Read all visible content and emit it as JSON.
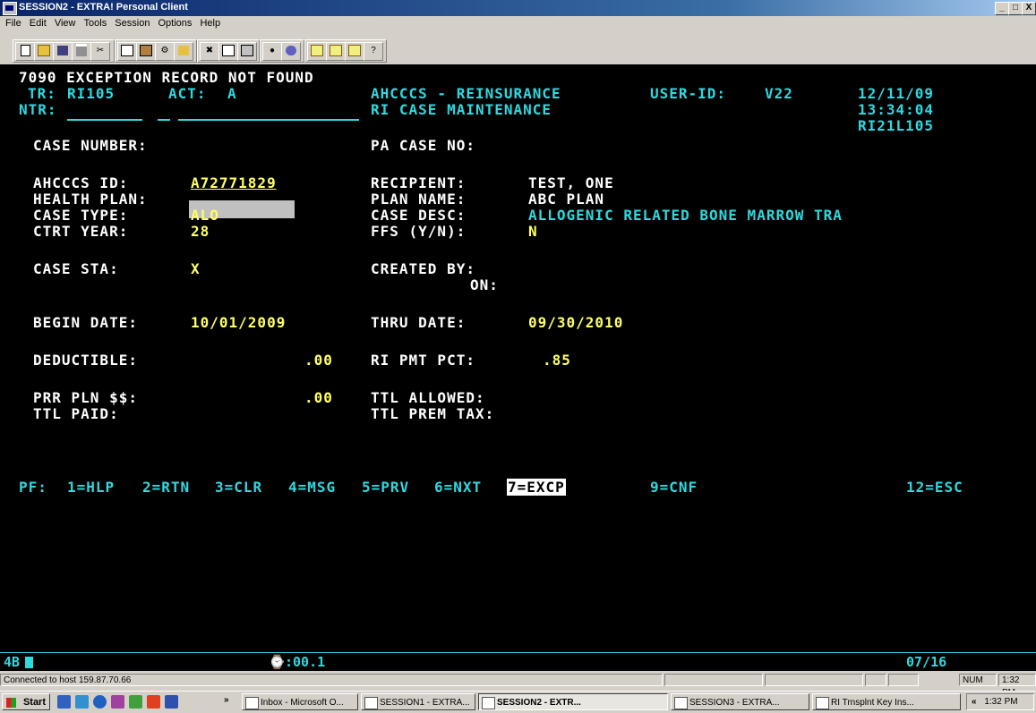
{
  "window": {
    "title": "SESSION2 - EXTRA! Personal Client",
    "controls": [
      "_",
      "□",
      "X"
    ]
  },
  "menu": [
    "File",
    "Edit",
    "View",
    "Tools",
    "Session",
    "Options",
    "Help"
  ],
  "screen": {
    "message": "7090 EXCEPTION RECORD NOT FOUND",
    "tr_label": "TR:",
    "tr_value": "RI105",
    "act_label": "ACT:",
    "act_value": "A",
    "ntr_label": "NTR:",
    "system_title": "AHCCCS - REINSURANCE",
    "screen_title": "RI CASE MAINTENANCE",
    "user_id_label": "USER-ID:",
    "user_id_value": "V22",
    "date": "12/11/09",
    "time": "13:34:04",
    "screen_id": "RI21L105",
    "case_number_label": "CASE NUMBER:",
    "pa_case_label": "PA CASE NO:",
    "ahcccs_id_label": "AHCCCS ID:",
    "ahcccs_id_value": "A72771829",
    "recipient_label": "RECIPIENT:",
    "recipient_value": "TEST, ONE",
    "health_plan_label": "HEALTH PLAN:",
    "plan_name_label": "PLAN NAME:",
    "plan_name_value": "ABC PLAN",
    "case_type_label": "CASE TYPE:",
    "case_type_value": "ALO",
    "case_desc_label": "CASE DESC:",
    "case_desc_value": "ALLOGENIC RELATED BONE MARROW TRA",
    "ctrt_year_label": "CTRT YEAR:",
    "ctrt_year_value": "28",
    "ffs_label": "FFS (Y/N):",
    "ffs_value": "N",
    "case_sta_label": "CASE STA:",
    "case_sta_value": "X",
    "created_by_label": "CREATED BY:",
    "on_label": "ON:",
    "begin_date_label": "BEGIN DATE:",
    "begin_date_value": "10/01/2009",
    "thru_date_label": "THRU DATE:",
    "thru_date_value": "09/30/2010",
    "deductible_label": "DEDUCTIBLE:",
    "deductible_value": ".00",
    "ri_pmt_pct_label": "RI PMT PCT:",
    "ri_pmt_pct_value": ".85",
    "prr_pln_label": "PRR PLN $$:",
    "prr_pln_value": ".00",
    "ttl_allowed_label": "TTL ALLOWED:",
    "ttl_paid_label": "TTL PAID:",
    "ttl_prem_tax_label": "TTL PREM TAX:",
    "pf_prefix": "PF:",
    "pf_keys": [
      "1=HLP",
      "2=RTN",
      "3=CLR",
      "4=MSG",
      "5=PRV",
      "6=NXT",
      "7=EXCP",
      "9=CNF",
      "12=ESC"
    ]
  },
  "oia": {
    "indicator": "4B",
    "timer": ":00.1",
    "cursor_pos": "07/16"
  },
  "status_bar": {
    "connection": "Connected to host 159.87.70.66",
    "num": "NUM",
    "time": "1:32 PM"
  },
  "taskbar": {
    "start": "Start",
    "chevron": "»",
    "tasks": [
      "Inbox - Microsoft O...",
      "SESSION1 - EXTRA...",
      "SESSION2 - EXTR...",
      "SESSION3 - EXTRA...",
      "RI Trnsplnt Key Ins..."
    ],
    "tray_chevron": "«",
    "clock": "1:32 PM"
  }
}
